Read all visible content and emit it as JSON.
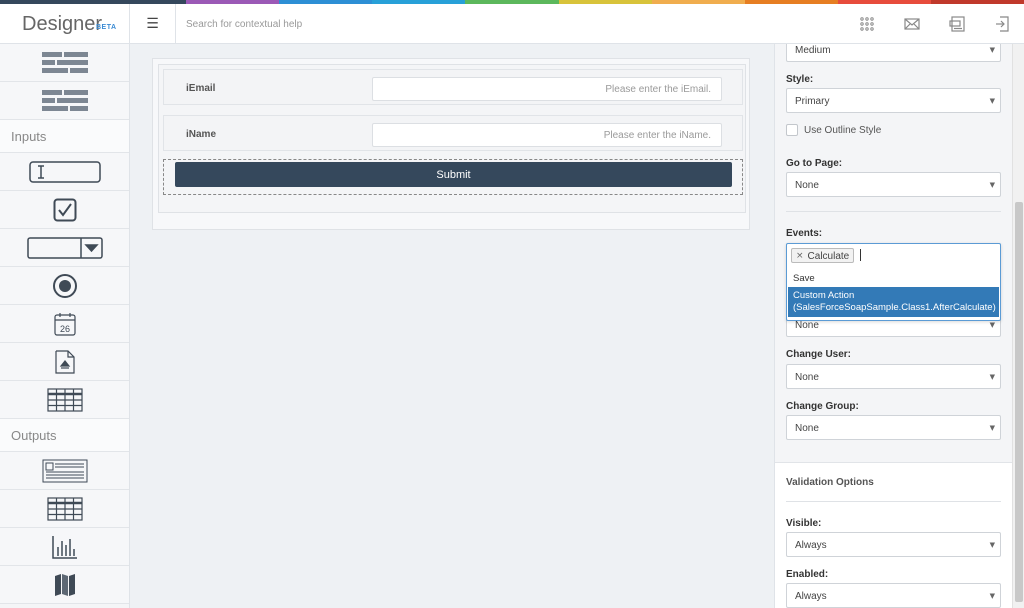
{
  "top_stripe_colors": [
    "#35485c",
    "#35485c",
    "#9b59b6",
    "#2d8fd5",
    "#27a0d8",
    "#5cb85c",
    "#d8c33a",
    "#f0ad4e",
    "#e67e22",
    "#e74c3c",
    "#c0392b"
  ],
  "app": {
    "name": "Designer",
    "badge": "BETA"
  },
  "header": {
    "menu_icon": "☰",
    "search_placeholder": "Search for contextual help",
    "icons": [
      "grid-icon",
      "mail-icon",
      "server-icon",
      "sign-out-icon"
    ]
  },
  "sidebar": {
    "layout_tools": [
      "rows-icon",
      "columns-icon"
    ],
    "inputs_label": "Inputs",
    "input_tools": [
      "textbox-icon",
      "checkbox-icon",
      "dropdown-icon",
      "radio-icon",
      "calendar-icon",
      "file-upload-icon",
      "table-input-icon"
    ],
    "calendar_day": "26",
    "outputs_label": "Outputs",
    "output_tools": [
      "text-output-icon",
      "table-output-icon",
      "chart-icon",
      "map-icon"
    ]
  },
  "form": {
    "rows": [
      {
        "label": "iEmail",
        "placeholder": "Please enter the iEmail."
      },
      {
        "label": "iName",
        "placeholder": "Please enter the iName."
      }
    ],
    "submit_label": "Submit"
  },
  "properties": {
    "size_value": "Medium",
    "style_label": "Style:",
    "style_value": "Primary",
    "outline_label": "Use Outline Style",
    "goto_label": "Go to Page:",
    "goto_value": "None",
    "events_label": "Events:",
    "events_tag": "Calculate",
    "events_tag_remove": "×",
    "events_options": {
      "save": "Save",
      "custom_line1": "Custom Action",
      "custom_line2": "(SalesForceSoapSample.Class1.AfterCalculate)"
    },
    "hidden_select_value": "None",
    "change_user_label": "Change User:",
    "change_user_value": "None",
    "change_group_label": "Change Group:",
    "change_group_value": "None",
    "validation_title": "Validation Options",
    "visible_label": "Visible:",
    "visible_value": "Always",
    "enabled_label": "Enabled:",
    "enabled_value": "Always",
    "caret": "▼"
  }
}
